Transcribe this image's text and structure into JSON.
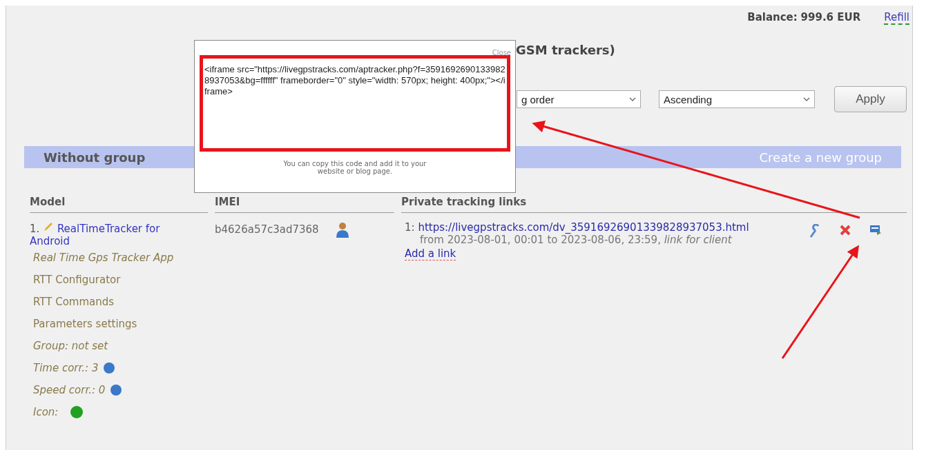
{
  "account": {
    "balance_label": "Balance:",
    "balance": "999.6 EUR",
    "refill": "Refill"
  },
  "title": "GSM trackers)",
  "sorting": {
    "field": "g order",
    "direction": "Ascending",
    "apply": "Apply"
  },
  "group": {
    "name": "Without group",
    "create": "Create a new group"
  },
  "table": {
    "columns": [
      "Model",
      "IMEI",
      "Private tracking links"
    ],
    "rows": [
      {
        "number": "1.",
        "model": "RealTimeTracker for Android",
        "app": "Real Time Gps Tracker App",
        "menu": [
          "RTT Configurator",
          "RTT Commands",
          "Parameters settings"
        ],
        "group": "Group: not set",
        "time_corr": "Time corr.: 3",
        "speed_corr": "Speed corr.: 0",
        "icon_label": "Icon:",
        "color": "#22a022",
        "imei": "b4626a57c3ad7368",
        "links": [
          {
            "number": "1:",
            "url": "https://livegpstracks.com/dv_35916926901339828937053.html",
            "period": "from 2023-08-01, 00:01 to 2023-08-06, 23:59,",
            "note": "link for client"
          }
        ],
        "add_link": "Add a link"
      }
    ]
  },
  "popup": {
    "close": "Close",
    "code": "<iframe src=\"https://livegpstracks.com/aptracker.php?f=35916926901339828937053&bg=ffffff\" frameborder=\"0\" style=\"width: 570px; height: 400px;\"></iframe>",
    "hint": "You can copy this code and add it to your website or blog page."
  }
}
